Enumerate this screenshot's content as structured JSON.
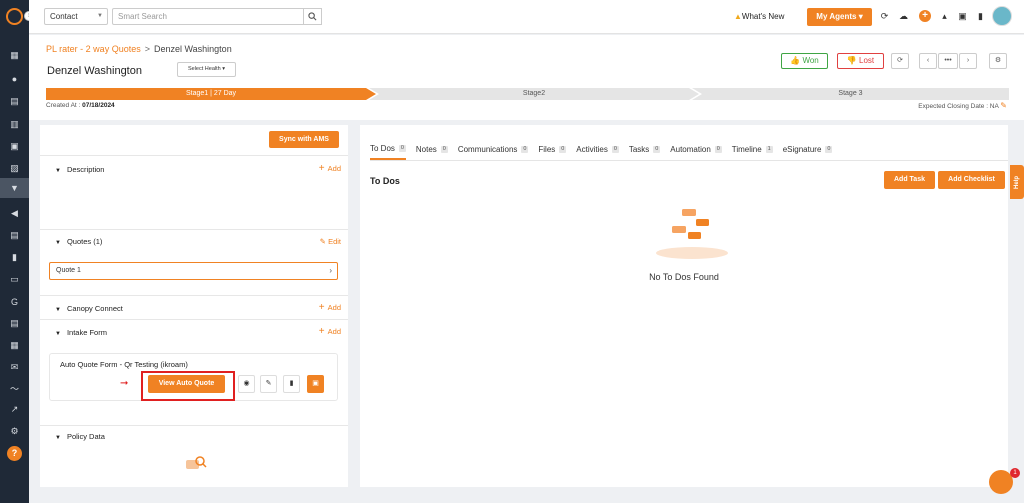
{
  "topbar": {
    "entity_select": "Contact",
    "search_placeholder": "Smart Search",
    "whats_new": "What's New",
    "my_agents": "My Agents"
  },
  "breadcrumb": {
    "parent": "PL rater - 2 way Quotes",
    "separator": ">",
    "current": "Denzel Washington"
  },
  "page_title": "Denzel Washington",
  "select_health": "Select Health",
  "actions": {
    "won": "Won",
    "lost": "Lost"
  },
  "stages": [
    {
      "label": "Stage1 | 27 Day",
      "active": true
    },
    {
      "label": "Stage2",
      "active": false
    },
    {
      "label": "Stage 3",
      "active": false
    }
  ],
  "created_at": {
    "label": "Created At :",
    "value": "07/18/2024"
  },
  "closing_date": {
    "label": "Expected Closing Date : NA"
  },
  "left_panel": {
    "sync_button": "Sync with AMS",
    "sections": {
      "description": {
        "title": "Description",
        "action": "Add"
      },
      "quotes": {
        "title": "Quotes (1)",
        "action": "Edit"
      },
      "quote_item": "Quote 1",
      "canopy": {
        "title": "Canopy Connect",
        "action": "Add"
      },
      "intake": {
        "title": "Intake Form",
        "action": "Add"
      },
      "policy": {
        "title": "Policy Data"
      }
    },
    "intake_card": {
      "title": "Auto Quote Form - Qr Testing (ikroam)",
      "view_button": "View Auto Quote"
    }
  },
  "tabs": [
    {
      "label": "To Dos",
      "count": "0",
      "active": true
    },
    {
      "label": "Notes",
      "count": "0"
    },
    {
      "label": "Communications",
      "count": "0"
    },
    {
      "label": "Files",
      "count": "0"
    },
    {
      "label": "Activities",
      "count": "0"
    },
    {
      "label": "Tasks",
      "count": "0"
    },
    {
      "label": "Automation",
      "count": "0"
    },
    {
      "label": "Timeline",
      "count": "1"
    },
    {
      "label": "eSignature",
      "count": "0"
    }
  ],
  "todos": {
    "heading": "To Dos",
    "add_task": "Add Task",
    "add_checklist": "Add Checklist",
    "empty": "No To Dos Found"
  },
  "help_tab": "Help",
  "chat_badge": "1",
  "colors": {
    "accent": "#f08223",
    "sidebar": "#1f2937",
    "won": "#3fa544",
    "lost": "#e04040"
  }
}
